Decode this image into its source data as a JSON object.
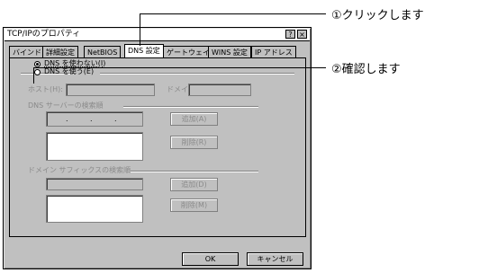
{
  "dialog": {
    "title": "TCP/IPのプロパティ",
    "help_button": "?",
    "close_button": "×",
    "tabs": [
      "バインド",
      "詳細設定",
      "NetBIOS",
      "DNS 設定",
      "ゲートウェイ",
      "WINS 設定",
      "IP アドレス"
    ],
    "active_tab": "DNS 設定",
    "dns_disable_label": "DNS を使わない(I)",
    "dns_enable_label": "DNS を使う(E)",
    "host_label": "ホスト(H):",
    "domain_label": "ドメイン(O):",
    "dns_search_order_label": "DNS サーバーの検索順",
    "ip_dot": ".",
    "add_button_1": "追加(A)",
    "remove_button_1": "削除(R)",
    "domain_suffix_label": "ドメイン サフィックスの検索順",
    "add_button_2": "追加(D)",
    "remove_button_2": "削除(M)",
    "ok_button": "OK",
    "cancel_button": "キャンセル"
  },
  "callouts": {
    "step1": "①クリックします",
    "step2": "②確認します"
  }
}
